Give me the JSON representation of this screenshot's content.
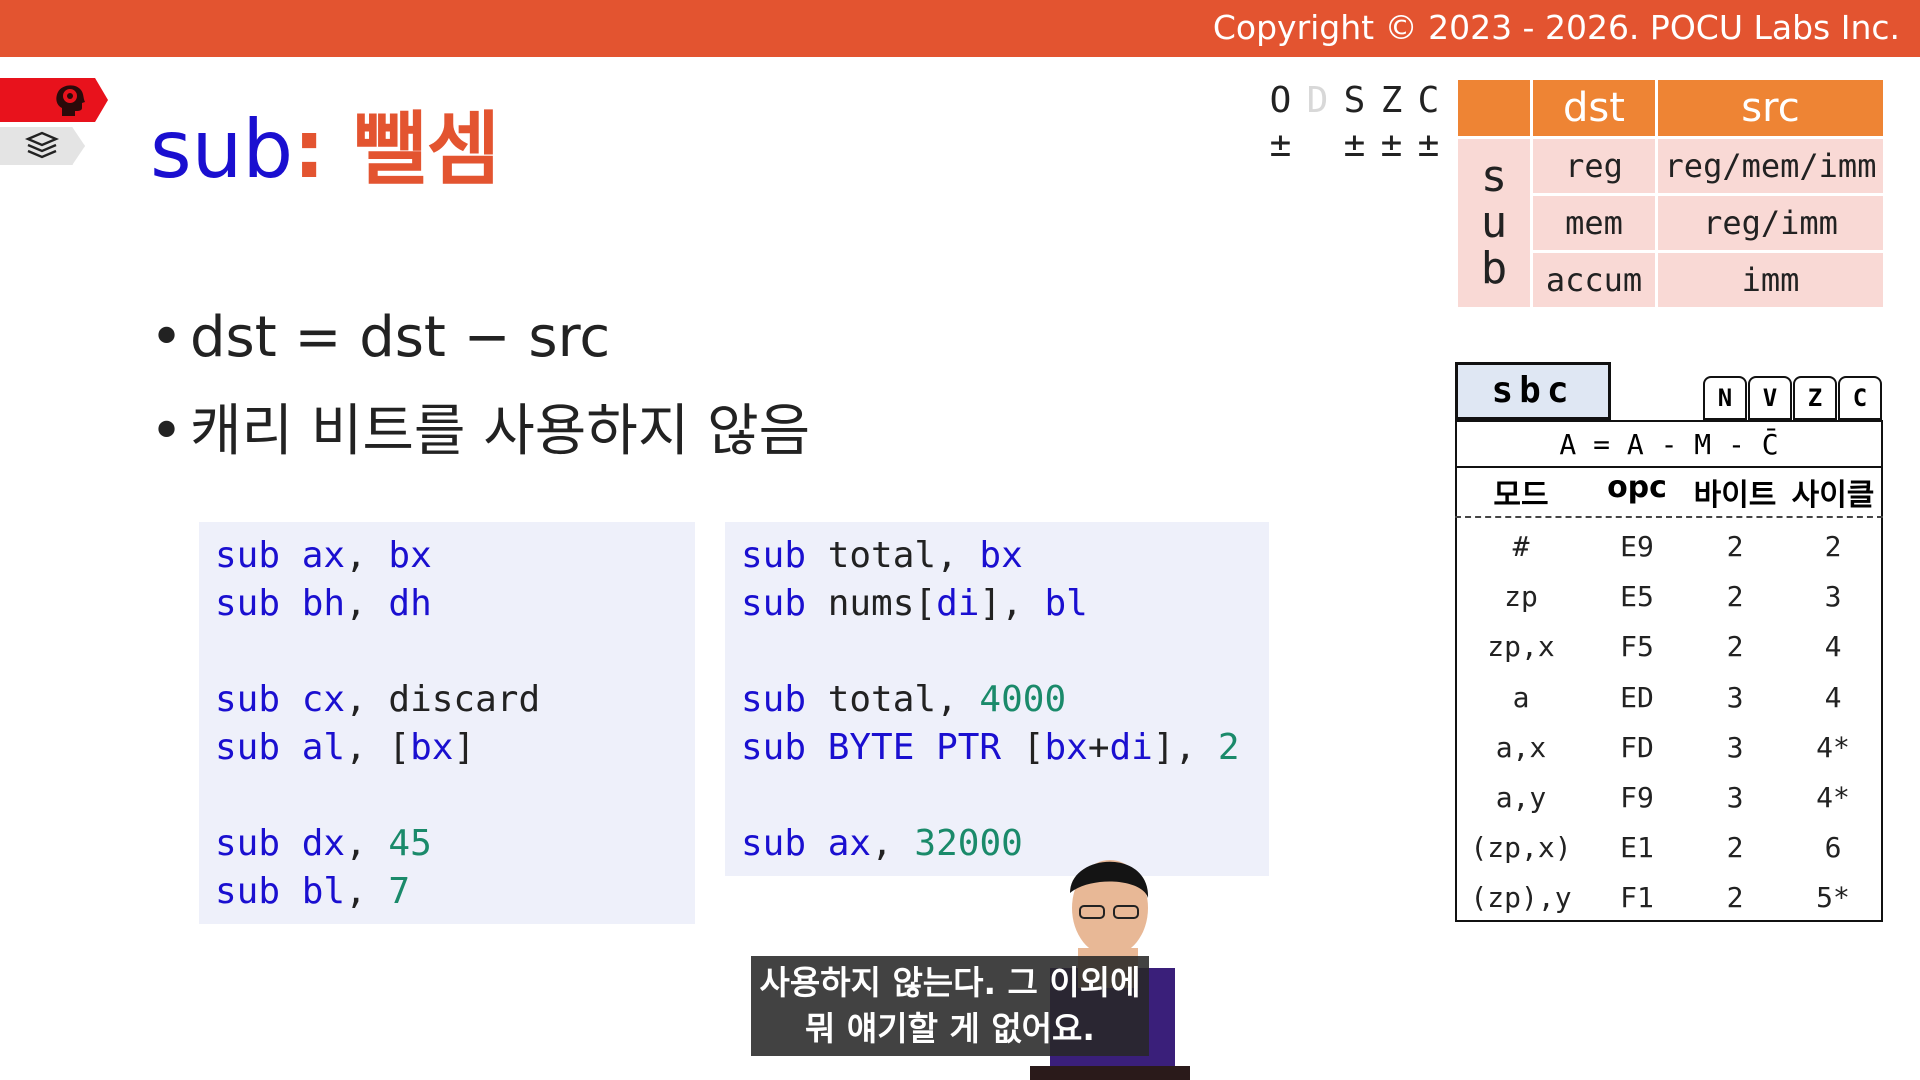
{
  "header": {
    "copyright": "Copyright © 2023 - 2026. POCU Labs Inc."
  },
  "nav": {
    "tag_top_icon": "brain-head-icon",
    "tag_bottom_icon": "book-stack-icon"
  },
  "slide": {
    "title_keyword": "sub",
    "title_colon": ":",
    "title_korean": " 뺄셈",
    "bullets": [
      "dst = dst − src",
      "캐리 비트를 사용하지 않음"
    ]
  },
  "code_left": [
    [
      [
        "sub ",
        "kwd"
      ],
      [
        "ax",
        "kwd"
      ],
      [
        ", ",
        ""
      ],
      [
        "bx",
        "kwd"
      ]
    ],
    [
      [
        "sub ",
        "kwd"
      ],
      [
        "bh",
        "kwd"
      ],
      [
        ", ",
        ""
      ],
      [
        "dh",
        "kwd"
      ]
    ],
    [],
    [
      [
        "sub ",
        "kwd"
      ],
      [
        "cx",
        "kwd"
      ],
      [
        ", discard",
        ""
      ]
    ],
    [
      [
        "sub ",
        "kwd"
      ],
      [
        "al",
        "kwd"
      ],
      [
        ", [",
        ""
      ],
      [
        "bx",
        "kwd"
      ],
      [
        "]",
        ""
      ]
    ],
    [],
    [
      [
        "sub ",
        "kwd"
      ],
      [
        "dx",
        "kwd"
      ],
      [
        ", ",
        ""
      ],
      [
        "45",
        "num"
      ]
    ],
    [
      [
        "sub ",
        "kwd"
      ],
      [
        "bl",
        "kwd"
      ],
      [
        ", ",
        ""
      ],
      [
        "7",
        "num"
      ]
    ]
  ],
  "code_right": [
    [
      [
        "sub ",
        "kwd"
      ],
      [
        "total, ",
        ""
      ],
      [
        "bx",
        "kwd"
      ]
    ],
    [
      [
        "sub ",
        "kwd"
      ],
      [
        "nums[",
        ""
      ],
      [
        "di",
        "kwd"
      ],
      [
        "], ",
        ""
      ],
      [
        "bl",
        "kwd"
      ]
    ],
    [],
    [
      [
        "sub ",
        "kwd"
      ],
      [
        "total, ",
        ""
      ],
      [
        "4000",
        "num"
      ]
    ],
    [
      [
        "sub ",
        "kwd"
      ],
      [
        "BYTE PTR",
        "kwd"
      ],
      [
        " [",
        ""
      ],
      [
        "bx",
        "kwd"
      ],
      [
        "+",
        ""
      ],
      [
        "di",
        "kwd"
      ],
      [
        "], ",
        ""
      ],
      [
        "2",
        "num"
      ]
    ],
    [],
    [
      [
        "sub ",
        "kwd"
      ],
      [
        "ax",
        "kwd"
      ],
      [
        ", ",
        ""
      ],
      [
        "32000",
        "num"
      ]
    ]
  ],
  "flags": {
    "names": [
      "O",
      "D",
      "S",
      "Z",
      "C"
    ],
    "values": [
      "±",
      "",
      "±",
      "±",
      "±"
    ],
    "dimmed": [
      false,
      true,
      false,
      false,
      false
    ]
  },
  "operand_table": {
    "headers": [
      "dst",
      "src"
    ],
    "side_label": [
      "s",
      "u",
      "b"
    ],
    "rows": [
      [
        "reg",
        "reg/mem/imm"
      ],
      [
        "mem",
        "reg/imm"
      ],
      [
        "accum",
        "imm"
      ]
    ]
  },
  "sbc": {
    "name": "sbc",
    "flags": [
      "N",
      "V",
      "Z",
      "C"
    ],
    "formula": "A = A - M - C̄",
    "columns": [
      "모드",
      "opc",
      "바이트",
      "사이클"
    ],
    "rows": [
      [
        "#",
        "E9",
        "2",
        "2"
      ],
      [
        "zp",
        "E5",
        "2",
        "3"
      ],
      [
        "zp,x",
        "F5",
        "2",
        "4"
      ],
      [
        "a",
        "ED",
        "3",
        "4"
      ],
      [
        "a,x",
        "FD",
        "3",
        "4*"
      ],
      [
        "a,y",
        "F9",
        "3",
        "4*"
      ],
      [
        "(zp,x)",
        "E1",
        "2",
        "6"
      ],
      [
        "(zp),y",
        "F1",
        "2",
        "5*"
      ]
    ]
  },
  "subtitle": {
    "line1": "사용하지 않는다. 그 이외에",
    "line2": "뭐 얘기할 게 없어요."
  }
}
